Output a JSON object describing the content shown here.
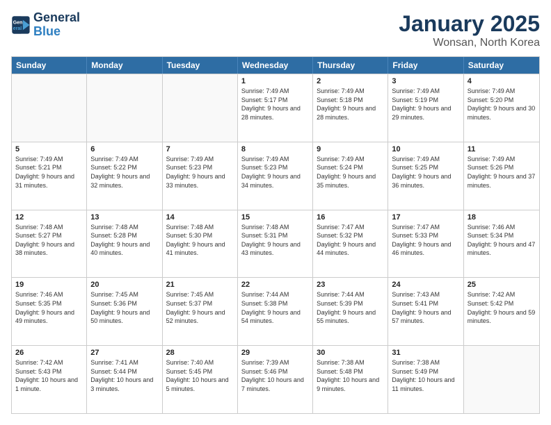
{
  "logo": {
    "line1": "General",
    "line2": "Blue"
  },
  "title": "January 2025",
  "subtitle": "Wonsan, North Korea",
  "header_days": [
    "Sunday",
    "Monday",
    "Tuesday",
    "Wednesday",
    "Thursday",
    "Friday",
    "Saturday"
  ],
  "rows": [
    [
      {
        "day": "",
        "text": ""
      },
      {
        "day": "",
        "text": ""
      },
      {
        "day": "",
        "text": ""
      },
      {
        "day": "1",
        "text": "Sunrise: 7:49 AM\nSunset: 5:17 PM\nDaylight: 9 hours and 28 minutes."
      },
      {
        "day": "2",
        "text": "Sunrise: 7:49 AM\nSunset: 5:18 PM\nDaylight: 9 hours and 28 minutes."
      },
      {
        "day": "3",
        "text": "Sunrise: 7:49 AM\nSunset: 5:19 PM\nDaylight: 9 hours and 29 minutes."
      },
      {
        "day": "4",
        "text": "Sunrise: 7:49 AM\nSunset: 5:20 PM\nDaylight: 9 hours and 30 minutes."
      }
    ],
    [
      {
        "day": "5",
        "text": "Sunrise: 7:49 AM\nSunset: 5:21 PM\nDaylight: 9 hours and 31 minutes."
      },
      {
        "day": "6",
        "text": "Sunrise: 7:49 AM\nSunset: 5:22 PM\nDaylight: 9 hours and 32 minutes."
      },
      {
        "day": "7",
        "text": "Sunrise: 7:49 AM\nSunset: 5:23 PM\nDaylight: 9 hours and 33 minutes."
      },
      {
        "day": "8",
        "text": "Sunrise: 7:49 AM\nSunset: 5:23 PM\nDaylight: 9 hours and 34 minutes."
      },
      {
        "day": "9",
        "text": "Sunrise: 7:49 AM\nSunset: 5:24 PM\nDaylight: 9 hours and 35 minutes."
      },
      {
        "day": "10",
        "text": "Sunrise: 7:49 AM\nSunset: 5:25 PM\nDaylight: 9 hours and 36 minutes."
      },
      {
        "day": "11",
        "text": "Sunrise: 7:49 AM\nSunset: 5:26 PM\nDaylight: 9 hours and 37 minutes."
      }
    ],
    [
      {
        "day": "12",
        "text": "Sunrise: 7:48 AM\nSunset: 5:27 PM\nDaylight: 9 hours and 38 minutes."
      },
      {
        "day": "13",
        "text": "Sunrise: 7:48 AM\nSunset: 5:28 PM\nDaylight: 9 hours and 40 minutes."
      },
      {
        "day": "14",
        "text": "Sunrise: 7:48 AM\nSunset: 5:30 PM\nDaylight: 9 hours and 41 minutes."
      },
      {
        "day": "15",
        "text": "Sunrise: 7:48 AM\nSunset: 5:31 PM\nDaylight: 9 hours and 43 minutes."
      },
      {
        "day": "16",
        "text": "Sunrise: 7:47 AM\nSunset: 5:32 PM\nDaylight: 9 hours and 44 minutes."
      },
      {
        "day": "17",
        "text": "Sunrise: 7:47 AM\nSunset: 5:33 PM\nDaylight: 9 hours and 46 minutes."
      },
      {
        "day": "18",
        "text": "Sunrise: 7:46 AM\nSunset: 5:34 PM\nDaylight: 9 hours and 47 minutes."
      }
    ],
    [
      {
        "day": "19",
        "text": "Sunrise: 7:46 AM\nSunset: 5:35 PM\nDaylight: 9 hours and 49 minutes."
      },
      {
        "day": "20",
        "text": "Sunrise: 7:45 AM\nSunset: 5:36 PM\nDaylight: 9 hours and 50 minutes."
      },
      {
        "day": "21",
        "text": "Sunrise: 7:45 AM\nSunset: 5:37 PM\nDaylight: 9 hours and 52 minutes."
      },
      {
        "day": "22",
        "text": "Sunrise: 7:44 AM\nSunset: 5:38 PM\nDaylight: 9 hours and 54 minutes."
      },
      {
        "day": "23",
        "text": "Sunrise: 7:44 AM\nSunset: 5:39 PM\nDaylight: 9 hours and 55 minutes."
      },
      {
        "day": "24",
        "text": "Sunrise: 7:43 AM\nSunset: 5:41 PM\nDaylight: 9 hours and 57 minutes."
      },
      {
        "day": "25",
        "text": "Sunrise: 7:42 AM\nSunset: 5:42 PM\nDaylight: 9 hours and 59 minutes."
      }
    ],
    [
      {
        "day": "26",
        "text": "Sunrise: 7:42 AM\nSunset: 5:43 PM\nDaylight: 10 hours and 1 minute."
      },
      {
        "day": "27",
        "text": "Sunrise: 7:41 AM\nSunset: 5:44 PM\nDaylight: 10 hours and 3 minutes."
      },
      {
        "day": "28",
        "text": "Sunrise: 7:40 AM\nSunset: 5:45 PM\nDaylight: 10 hours and 5 minutes."
      },
      {
        "day": "29",
        "text": "Sunrise: 7:39 AM\nSunset: 5:46 PM\nDaylight: 10 hours and 7 minutes."
      },
      {
        "day": "30",
        "text": "Sunrise: 7:38 AM\nSunset: 5:48 PM\nDaylight: 10 hours and 9 minutes."
      },
      {
        "day": "31",
        "text": "Sunrise: 7:38 AM\nSunset: 5:49 PM\nDaylight: 10 hours and 11 minutes."
      },
      {
        "day": "",
        "text": ""
      }
    ]
  ]
}
